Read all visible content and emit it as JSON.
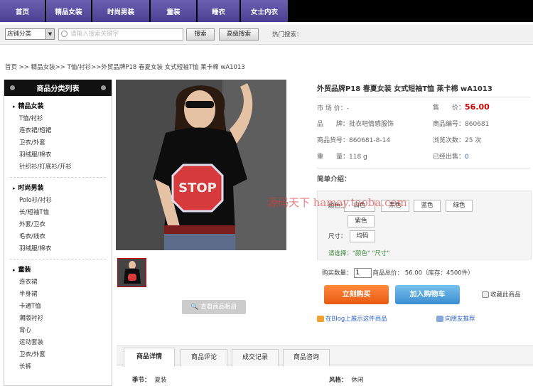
{
  "nav": {
    "tabs": [
      "首页",
      "精品女装",
      "时尚男装",
      "童装",
      "睡衣",
      "女士内衣"
    ]
  },
  "search": {
    "category_select": "店铺分类",
    "placeholder": "请输入搜索关键字",
    "search_button": "搜索",
    "advanced_button": "高级搜索",
    "hot_label": "热门搜索："
  },
  "breadcrumb": "首页 >> 精品女装>> T恤/衬衫>>外贸品牌P18 春夏女装 女式短袖T恤 莱卡棉 wA1013",
  "sidebar": {
    "title": "商品分类列表",
    "categories": [
      {
        "name": "精品女装",
        "items": [
          "T恤/衬衫",
          "连衣裙/短裙",
          "卫衣/外套",
          "羽绒服/棉衣",
          "针织衫/打底衫/开衫"
        ]
      },
      {
        "name": "时尚男装",
        "items": [
          "Polo衫/衬衫",
          "长/短袖T恤",
          "外套/卫衣",
          "毛衣/线衣",
          "羽绒服/棉衣"
        ]
      },
      {
        "name": "童装",
        "items": [
          "连衣裙",
          "半身裙",
          "卡通T恤",
          "潮版衬衫",
          "背心",
          "运动套装",
          "卫衣/外套",
          "长裤"
        ]
      }
    ]
  },
  "product": {
    "title": "外贸品牌P18 春夏女装 女式短袖T恤 莱卡棉 wA1013",
    "market_price_label": "市 场 价：",
    "market_price": "-",
    "price_label": "售　　价：",
    "price": "56.00",
    "brand_label": "品　　牌：",
    "brand": "批衣吧情感服饰",
    "code_label": "商品编号：",
    "code": "860681",
    "sku_label": "商品货号：",
    "sku": "860681-8-14",
    "views_label": "浏览次数：",
    "views": "25 次",
    "weight_label": "重　　量：",
    "weight": "118 g",
    "sold_label": "已经出售：",
    "sold": "0",
    "intro_label": "简单介绍：",
    "color_label": "颜色：",
    "colors": [
      "白色",
      "黑色",
      "蓝色",
      "绿色",
      "紫色"
    ],
    "size_label": "尺寸：",
    "sizes": [
      "均码"
    ],
    "pick_hint": "请选择：\"颜色\" \"尺寸\"",
    "qty_label": "购买数量：",
    "qty_value": "1",
    "total_text": "商品总价：  56.00（库存：4500件）",
    "buy_button": "立刻购买",
    "cart_button": "加入购物车",
    "fav_label": "收藏此商品",
    "blog_link": "在Blog上展示这件商品",
    "recommend_link": "向朋友推荐",
    "view_image_button": "查看商品相册",
    "tshirt_text": "STOP"
  },
  "watermark": "源码天下 hamay.taoba.com",
  "detail_tabs": [
    "商品详情",
    "商品评论",
    "成交记录",
    "商品咨询"
  ],
  "specs": [
    {
      "label": "季节：",
      "value": "夏装"
    },
    {
      "label": "风格：",
      "value": "休闲"
    }
  ]
}
